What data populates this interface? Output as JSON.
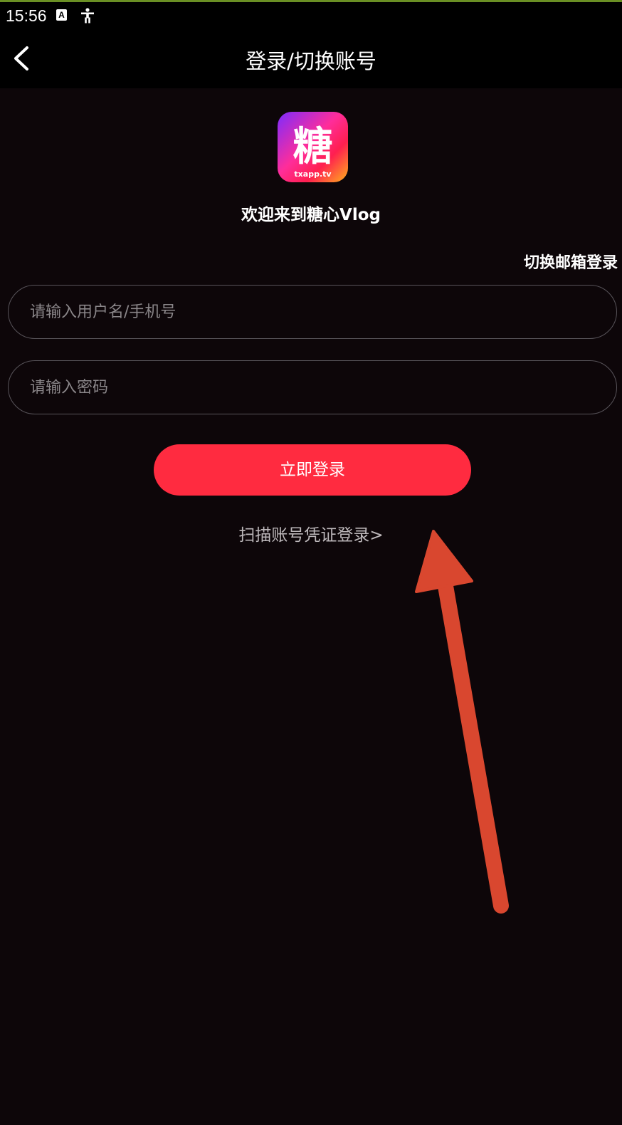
{
  "status_bar": {
    "time": "15:56",
    "icons": [
      "a-badge-icon",
      "accessibility-icon"
    ]
  },
  "app_bar": {
    "title": "登录/切换账号",
    "back_icon": "chevron-left-icon"
  },
  "logo": {
    "glyph": "糖",
    "caption": "txapp.tv"
  },
  "welcome_text": "欢迎来到糖心Vlog",
  "switch_email_label": "切换邮箱登录",
  "form": {
    "username_placeholder": "请输入用户名/手机号",
    "username_value": "",
    "password_placeholder": "请输入密码",
    "password_value": ""
  },
  "login_button_label": "立即登录",
  "scan_login_label": "扫描账号凭证登录>",
  "colors": {
    "background": "#0d0609",
    "accent": "#ff2b40",
    "annotation_arrow": "#d9472f"
  }
}
